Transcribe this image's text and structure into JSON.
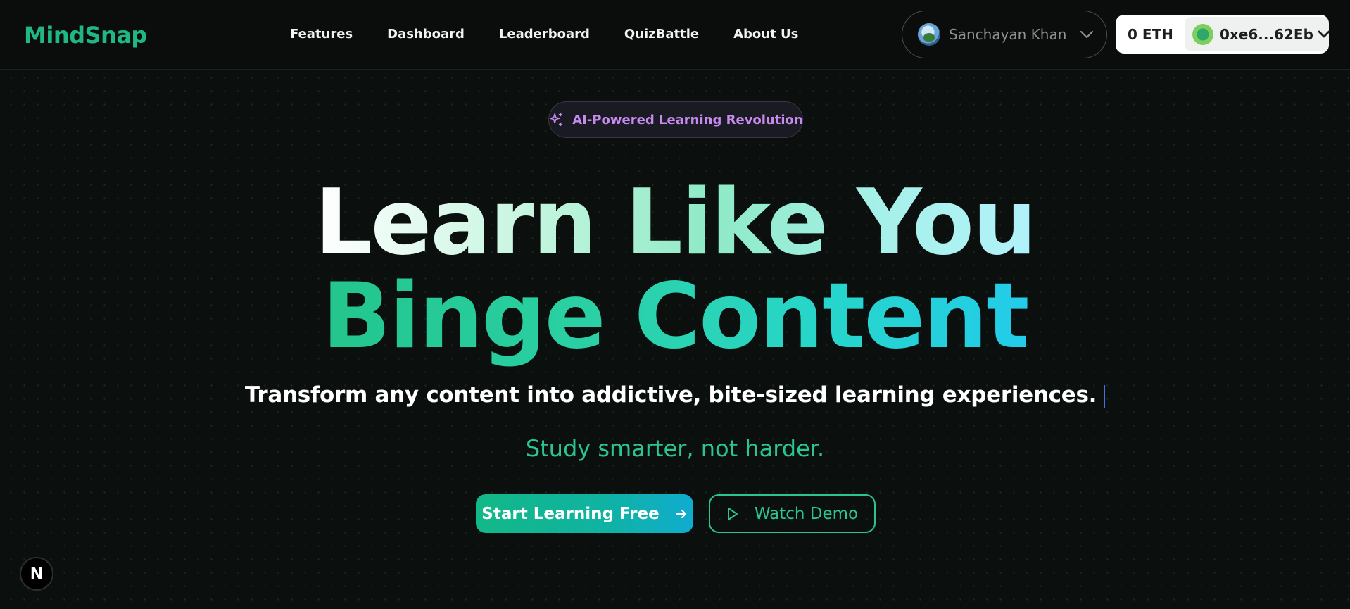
{
  "brand": {
    "logo_text": "MindSnap",
    "accent": "#1fb884"
  },
  "nav": {
    "items": [
      {
        "label": "Features"
      },
      {
        "label": "Dashboard"
      },
      {
        "label": "Leaderboard"
      },
      {
        "label": "QuizBattle"
      },
      {
        "label": "About Us"
      }
    ]
  },
  "user": {
    "name": "Sanchayan Khan",
    "avatar_icon": "user-avatar",
    "menu_icon": "chevron-down-icon"
  },
  "wallet": {
    "balance": "0 ETH",
    "address": "0xe6...62Eb",
    "menu_icon": "chevron-down-icon"
  },
  "hero": {
    "badge": {
      "icon": "sparkles-icon",
      "text": "AI-Powered Learning Revolution",
      "color": "#c78bf0"
    },
    "headline_line1": "Learn Like You",
    "headline_line2": "Binge Content",
    "subheadline": "Transform any content into addictive, bite-sized learning experiences.",
    "tagline": "Study smarter, not harder.",
    "primary_cta": {
      "label": "Start Learning Free",
      "icon": "arrow-right-icon"
    },
    "secondary_cta": {
      "label": "Watch Demo",
      "icon": "play-icon"
    }
  },
  "dev_badge": {
    "text": "N"
  }
}
